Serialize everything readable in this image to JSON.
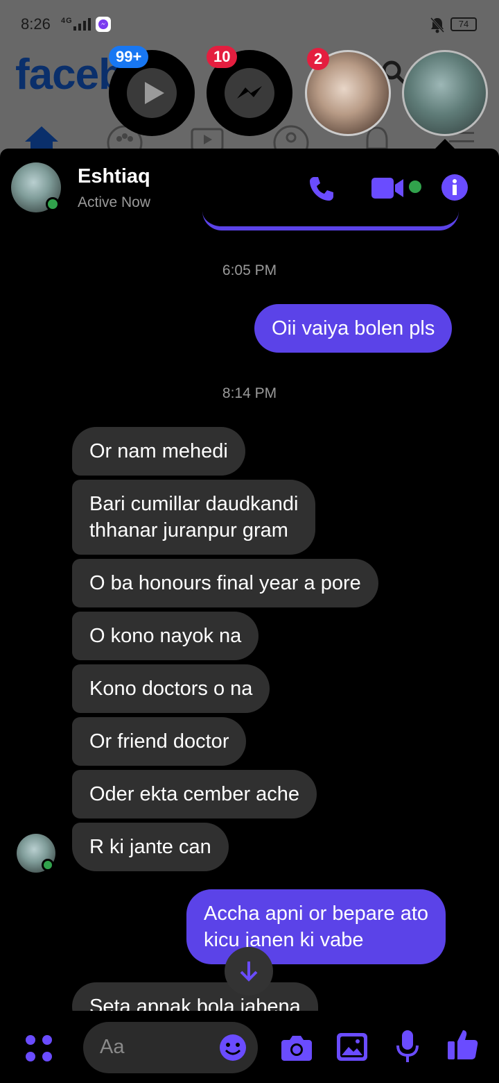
{
  "status_bar": {
    "time": "8:26",
    "network": "4G",
    "battery": "74"
  },
  "background_app": {
    "logo": "faceb",
    "search_icon": "search-icon"
  },
  "chat_heads": [
    {
      "name": "video-chat-head",
      "badge": "99+",
      "badge_color": "#1877f2"
    },
    {
      "name": "messenger-chat-head",
      "badge": "10",
      "badge_color": "#e41e3f"
    },
    {
      "name": "couple-photo-chat-head",
      "badge": "2",
      "badge_color": "#e41e3f"
    },
    {
      "name": "eshtiaq-chat-head",
      "badge": "",
      "badge_color": "#e41e3f"
    }
  ],
  "header": {
    "name": "Eshtiaq",
    "status": "Active Now",
    "accent": "#5b43e8"
  },
  "messages": [
    {
      "type": "timestamp",
      "text": "6:05 PM"
    },
    {
      "type": "out",
      "text": "Oii vaiya bolen pls"
    },
    {
      "type": "timestamp",
      "text": "8:14 PM"
    },
    {
      "type": "in",
      "text": "Or nam mehedi"
    },
    {
      "type": "in",
      "lines": [
        "Bari cumillar daudkandi",
        "thhanar juranpur gram"
      ]
    },
    {
      "type": "in",
      "text": "O ba honours final year a pore"
    },
    {
      "type": "in",
      "text": "O kono nayok na"
    },
    {
      "type": "in",
      "text": "Kono doctors o na"
    },
    {
      "type": "in",
      "text": "Or friend doctor"
    },
    {
      "type": "in",
      "text": "Oder ekta cember ache"
    },
    {
      "type": "in",
      "text": "R ki jante can"
    },
    {
      "type": "out",
      "lines": [
        "Accha apni or bepare ato",
        "kicu janen ki vabe"
      ]
    },
    {
      "type": "in",
      "text": "Seta apnak bola jabena"
    }
  ],
  "composer": {
    "placeholder": "Aa"
  }
}
